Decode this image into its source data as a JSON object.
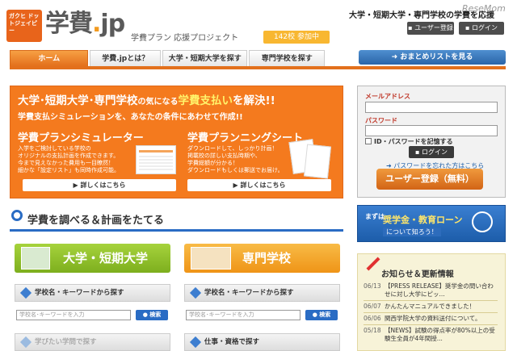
{
  "header": {
    "logo_badge": "ガクヒ ドットジェイピー",
    "logo_main": "学費",
    "logo_dot": ".",
    "logo_jp": "jp",
    "tagline": "学費プラン 応援プロジェクト",
    "members": "142校 参加中",
    "top_tagline": "大学・短期大学・専門学校の学費を応援",
    "watermark": "ReseMom",
    "user_register": "ユーザー登録",
    "login": "ログイン",
    "matome_button": "おまとめリストを見る"
  },
  "nav": {
    "items": [
      {
        "label": "ホーム"
      },
      {
        "label": "学費.jpとは？"
      },
      {
        "label": "大学・短期大学を探す"
      },
      {
        "label": "専門学校を探す"
      }
    ]
  },
  "hero": {
    "title_a": "大学･短期大学･専門学校",
    "title_b": "の気になる",
    "title_c": "学費支払い",
    "title_d": "を解決!!",
    "subtitle": "学費支払シミュレーションを、あなたの条件にあわせて作成!!",
    "sim_title": "学費プランシミュレーター",
    "sim_desc": [
      "入学をご検討している学校の",
      "オリジナルの支払計画を作成できます。",
      "今まで見えなかった費用も一目瞭然！",
      "細かな「設定リスト」も同時作成可能。"
    ],
    "sim_button": "詳しくはこちら",
    "sheet_title": "学費プランニングシート",
    "sheet_desc": [
      "ダウンロードして、しっかり計画！",
      "掲載校の詳しい支払時期や、",
      "学費総額が分かる！",
      "ダウンロードもしくは郵送でお届け。"
    ],
    "sheet_button": "詳しくはこちら"
  },
  "login_box": {
    "mail_label": "メールアドレス",
    "password_label": "パスワード",
    "remember_label": "ID・パスワードを記憶する",
    "login_button": "ログイン",
    "forgot_link": "パスワードを忘れた方はこちら",
    "register_button": "ユーザー登録（無料）"
  },
  "section": {
    "title": "学費を調べる＆計画をたてる"
  },
  "cards": [
    {
      "title": "大学・短期大学",
      "search_heading": "学校名・キーワードから探す",
      "placeholder": "学校名･キーワードを入力",
      "search_button": "検索",
      "next_heading": "学びたい学問で探す",
      "color": "#8cbf26"
    },
    {
      "title": "専門学校",
      "search_heading": "学校名・キーワードから探す",
      "placeholder": "学校名･キーワードを入力",
      "search_button": "検索",
      "next_heading": "仕事・資格で探す",
      "color": "#f4a11e"
    }
  ],
  "loan": {
    "pre": "まずは",
    "title": "奨学金・教育ローン",
    "sub": "について知ろう！"
  },
  "news": {
    "title": "お知らせ＆更新情報",
    "items": [
      {
        "date": "06/13",
        "text": "【PRESS RELEASE】奨学金の問い合わせに対し大学にピッ..."
      },
      {
        "date": "06/07",
        "text": "かんたんマニュアルできました！"
      },
      {
        "date": "06/06",
        "text": "関西学院大学の資料送付について。"
      },
      {
        "date": "05/18",
        "text": "【NEWS】試験の得点率が80%以上の受験生全員が4年間授..."
      }
    ]
  },
  "colors": {
    "brand_orange": "#e3701c",
    "brand_blue": "#2a6cc4"
  }
}
